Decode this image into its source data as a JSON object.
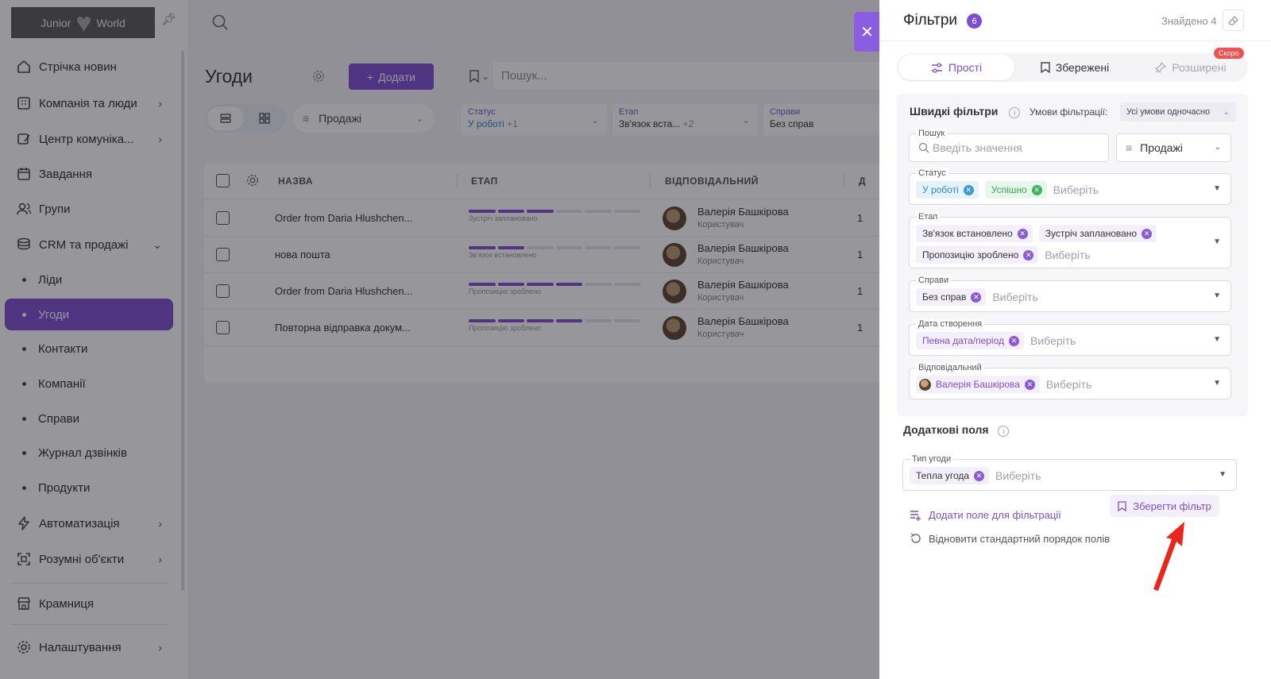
{
  "sidebar": {
    "logo_left": "Junior",
    "logo_right": "World",
    "items": [
      {
        "label": "Стрічка новин"
      },
      {
        "label": "Компанія та люди"
      },
      {
        "label": "Центр комуніка..."
      },
      {
        "label": "Завдання"
      },
      {
        "label": "Групи"
      },
      {
        "label": "CRM та продажі"
      },
      {
        "label": "Ліди"
      },
      {
        "label": "Угоди"
      },
      {
        "label": "Контакти"
      },
      {
        "label": "Компанії"
      },
      {
        "label": "Справи"
      },
      {
        "label": "Журнал дзвінків"
      },
      {
        "label": "Продукти"
      },
      {
        "label": "Автоматизація"
      },
      {
        "label": "Розумні об'єкти"
      },
      {
        "label": "Крамниця"
      },
      {
        "label": "Налаштування"
      }
    ]
  },
  "main": {
    "title": "Угоди",
    "add_label": "Додати",
    "search_placeholder": "Пошук...",
    "pipeline": "Продажі",
    "chips": [
      {
        "label": "Статус",
        "value": "У роботі",
        "more": "+1"
      },
      {
        "label": "Етап",
        "value": "Зв'язок вста...",
        "more": "+2"
      },
      {
        "label": "Справи",
        "value": "Без справ",
        "more": ""
      }
    ],
    "columns": [
      "НАЗВА",
      "ЕТАП",
      "ВІДПОВІДАЛЬНИЙ",
      "Д"
    ],
    "rows": [
      {
        "name": "Order from Daria Hlushchen...",
        "stage_label": "Зустріч заплановано",
        "progress_steps": 3,
        "user": "Валерія Башкірова",
        "role": "Користувач",
        "extra": "1"
      },
      {
        "name": "нова пошта",
        "stage_label": "Зв'язок встановлено",
        "progress_steps": 2,
        "user": "Валерія Башкірова",
        "role": "Користувач",
        "extra": "1"
      },
      {
        "name": "Order from Daria Hlushchen...",
        "stage_label": "Пропозицію зроблено",
        "progress_steps": 4,
        "user": "Валерія Башкірова",
        "role": "Користувач",
        "extra": "1"
      },
      {
        "name": "Повторна відправка докум...",
        "stage_label": "Пропозицію зроблено",
        "progress_steps": 4,
        "user": "Валерія Башкірова",
        "role": "Користувач",
        "extra": "1"
      }
    ]
  },
  "panel": {
    "title": "Фільтри",
    "count": "6",
    "found": "Знайдено 4",
    "tabs": {
      "simple": "Прості",
      "saved": "Збережені",
      "advanced": "Розширені",
      "soon": "Скоро"
    },
    "quick_title": "Швидкі фільтри",
    "conditions_label": "Умови фільтрації:",
    "conditions_value": "Усі умови одночасно",
    "search_label": "Пошук",
    "search_placeholder": "Введіть значення",
    "pipeline": "Продажі",
    "placeholder": "Виберіть",
    "status": {
      "label": "Статус",
      "tags": [
        "У роботі",
        "Успішно"
      ]
    },
    "stage": {
      "label": "Етап",
      "tags": [
        "Зв'язок встановлено",
        "Зустріч заплановано",
        "Пропозицію зроблено"
      ]
    },
    "tasks": {
      "label": "Справи",
      "tags": [
        "Без справ"
      ]
    },
    "created": {
      "label": "Дата створення",
      "tags": [
        "Певна дата/період"
      ]
    },
    "responsible": {
      "label": "Відповідальний",
      "tags": [
        "Валерія Башкірова"
      ]
    },
    "extra_title": "Додаткові поля",
    "deal_type": {
      "label": "Тип угоди",
      "tags": [
        "Тепла угода"
      ]
    },
    "add_field": "Додати поле для фільтрації",
    "save_filter": "Зберегти фільтр",
    "reset_order": "Відновити стандартний порядок полів"
  },
  "colors": {
    "accent": "#7d4fd0",
    "annotation_arrow": "#e8261c",
    "soon_badge": "#ef5350"
  }
}
